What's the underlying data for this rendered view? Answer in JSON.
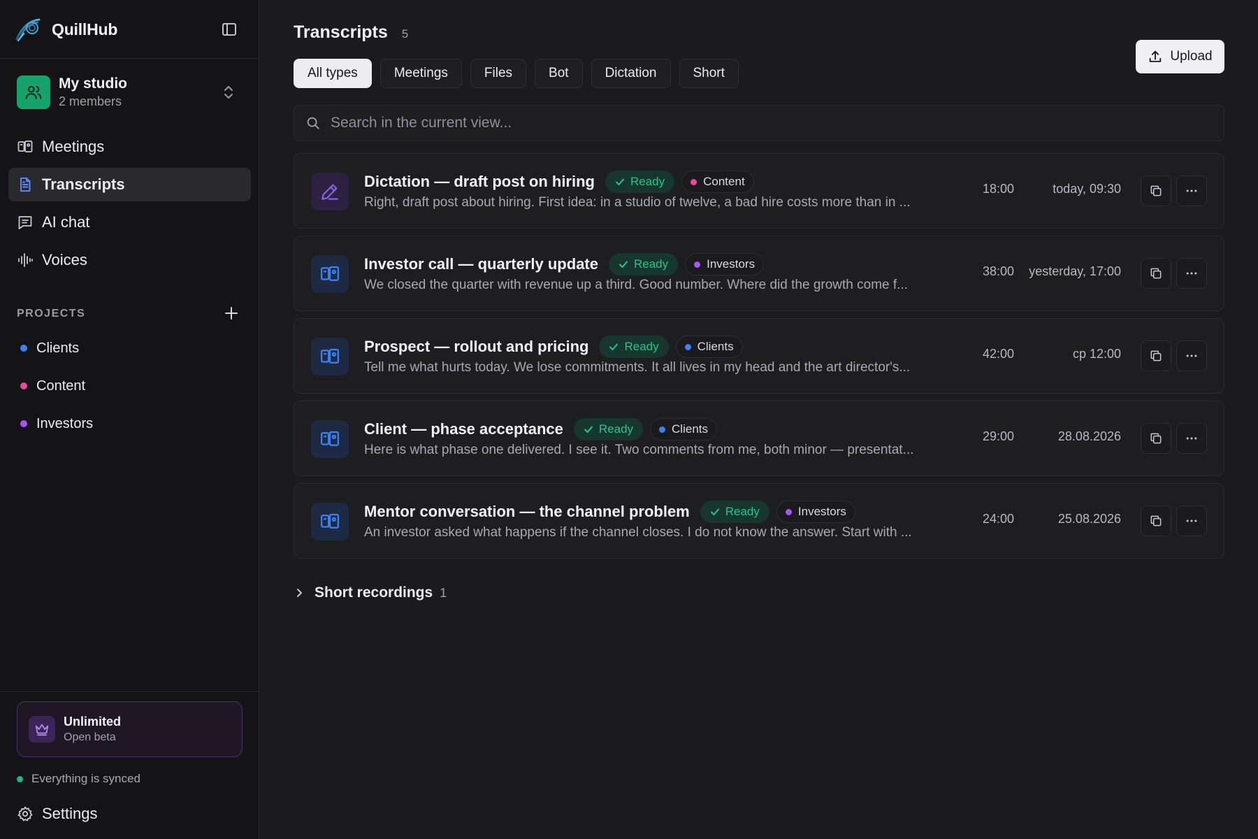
{
  "brand": {
    "name": "QuillHub"
  },
  "workspace": {
    "name": "My studio",
    "members": "2 members"
  },
  "nav": {
    "meetings": "Meetings",
    "transcripts": "Transcripts",
    "ai_chat": "AI chat",
    "voices": "Voices"
  },
  "projects": {
    "header": "PROJECTS",
    "items": [
      {
        "label": "Clients",
        "color": "#3b82f6"
      },
      {
        "label": "Content",
        "color": "#ec4899"
      },
      {
        "label": "Investors",
        "color": "#a855f7"
      }
    ]
  },
  "plan": {
    "title": "Unlimited",
    "subtitle": "Open beta"
  },
  "sync_status": "Everything is synced",
  "settings_label": "Settings",
  "page": {
    "title": "Transcripts",
    "count": "5"
  },
  "upload_label": "Upload",
  "filters": [
    "All types",
    "Meetings",
    "Files",
    "Bot",
    "Dictation",
    "Short"
  ],
  "active_filter": "All types",
  "search": {
    "placeholder": "Search in the current view..."
  },
  "status_label": "Ready",
  "colors": {
    "ready_green": "#28c38f",
    "accent_blue": "#3b82f6",
    "dictation_purple": "#8b5cf6"
  },
  "transcripts": [
    {
      "type": "dictation",
      "icon": "pen-icon",
      "title": "Dictation — draft post on hiring",
      "project": "Content",
      "project_color": "#ec4899",
      "snippet": "Right, draft post about hiring. First idea: in a studio of twelve, a bad hire costs more than in ...",
      "duration": "18:00",
      "date": "today, 09:30"
    },
    {
      "type": "meeting",
      "icon": "meeting-icon",
      "title": "Investor call — quarterly update",
      "project": "Investors",
      "project_color": "#a855f7",
      "snippet": "We closed the quarter with revenue up a third. Good number. Where did the growth come f...",
      "duration": "38:00",
      "date": "yesterday, 17:00"
    },
    {
      "type": "meeting",
      "icon": "meeting-icon",
      "title": "Prospect — rollout and pricing",
      "project": "Clients",
      "project_color": "#3b82f6",
      "snippet": "Tell me what hurts today. We lose commitments. It all lives in my head and the art director's...",
      "duration": "42:00",
      "date": "ср 12:00"
    },
    {
      "type": "meeting",
      "icon": "meeting-icon",
      "title": "Client — phase acceptance",
      "project": "Clients",
      "project_color": "#3b82f6",
      "snippet": "Here is what phase one delivered. I see it. Two comments from me, both minor — presentat...",
      "duration": "29:00",
      "date": "28.08.2026"
    },
    {
      "type": "meeting",
      "icon": "meeting-icon",
      "title": "Mentor conversation — the channel problem",
      "project": "Investors",
      "project_color": "#a855f7",
      "snippet": "An investor asked what happens if the channel closes. I do not know the answer. Start with ...",
      "duration": "24:00",
      "date": "25.08.2026"
    }
  ],
  "short_recordings": {
    "label": "Short recordings",
    "count": "1"
  }
}
